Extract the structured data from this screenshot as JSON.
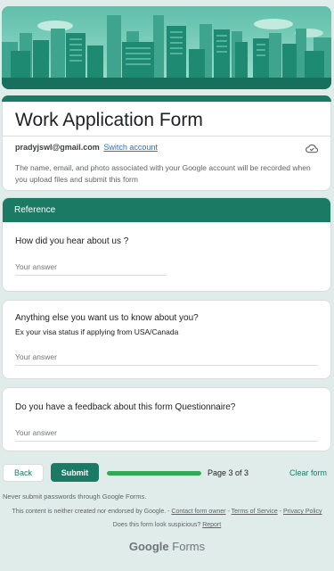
{
  "form": {
    "title": "Work Application Form",
    "account_email": "pradyjswl@gmail.com",
    "switch_account": "Switch account",
    "notice": "The name, email, and photo associated with your Google account will be recorded when you upload files and submit this form"
  },
  "section": {
    "title": "Reference"
  },
  "questions": [
    {
      "label": "How did you hear about us ?",
      "description": "",
      "placeholder": "Your answer"
    },
    {
      "label": "Anything else you want us to know about you?",
      "description": "Ex your visa status if applying from USA/Canada",
      "placeholder": "Your answer"
    },
    {
      "label": "Do you have a feedback about this form Questionnaire?",
      "description": "",
      "placeholder": "Your answer"
    }
  ],
  "nav": {
    "back_label": "Back",
    "submit_label": "Submit",
    "progress": 1.0,
    "page_text": "Page 3 of 3",
    "clear_label": "Clear form"
  },
  "footer": {
    "warning": "Never submit passwords through Google Forms.",
    "legal_text": "This content is neither created nor endorsed by Google. - ",
    "contact_owner": "Contact form owner",
    "sep1": " - ",
    "terms": "Terms of Service",
    "sep2": " - ",
    "privacy": "Privacy Policy",
    "suspicious_text": "Does this form look suspicious? ",
    "report": "Report",
    "logo_google": "Google",
    "logo_forms": " Forms"
  },
  "colors": {
    "theme": "#1b7a64",
    "progress": "#34a853",
    "background": "#e0ece9"
  },
  "icons": {
    "account_status": "cloud-done-icon"
  }
}
